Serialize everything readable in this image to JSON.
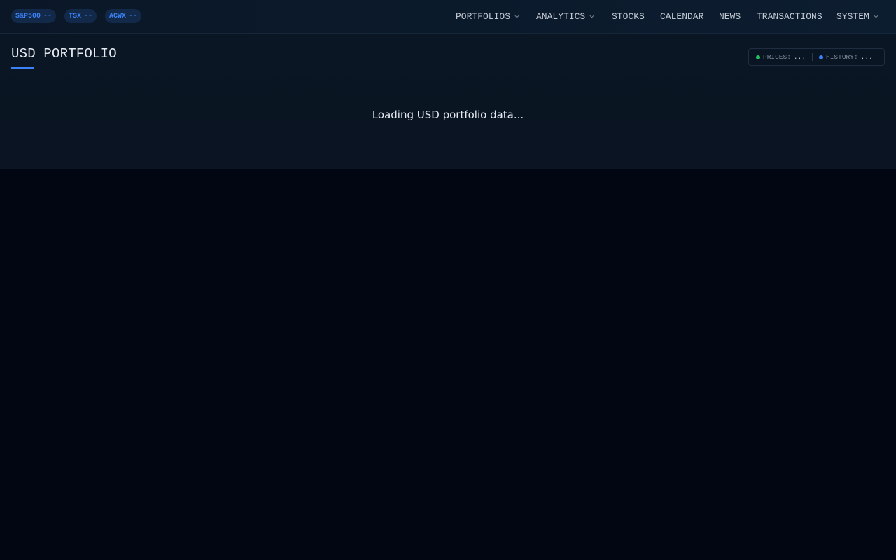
{
  "tickers": [
    {
      "symbol": "S&P500",
      "value": "--"
    },
    {
      "symbol": "TSX",
      "value": "--"
    },
    {
      "symbol": "ACWX",
      "value": "--"
    }
  ],
  "nav": {
    "portfolios": "PORTFOLIOS",
    "analytics": "ANALYTICS",
    "stocks": "STOCKS",
    "calendar": "CALENDAR",
    "news": "NEWS",
    "transactions": "TRANSACTIONS",
    "system": "SYSTEM"
  },
  "page": {
    "title": "USD PORTFOLIO",
    "loading_text": "Loading USD portfolio data..."
  },
  "status": {
    "prices_label": "PRICES:",
    "prices_value": "...",
    "history_label": "HISTORY:",
    "history_value": "..."
  },
  "colors": {
    "accent": "#3b82f6",
    "prices_dot": "#22c55e",
    "history_dot": "#3b82f6"
  }
}
